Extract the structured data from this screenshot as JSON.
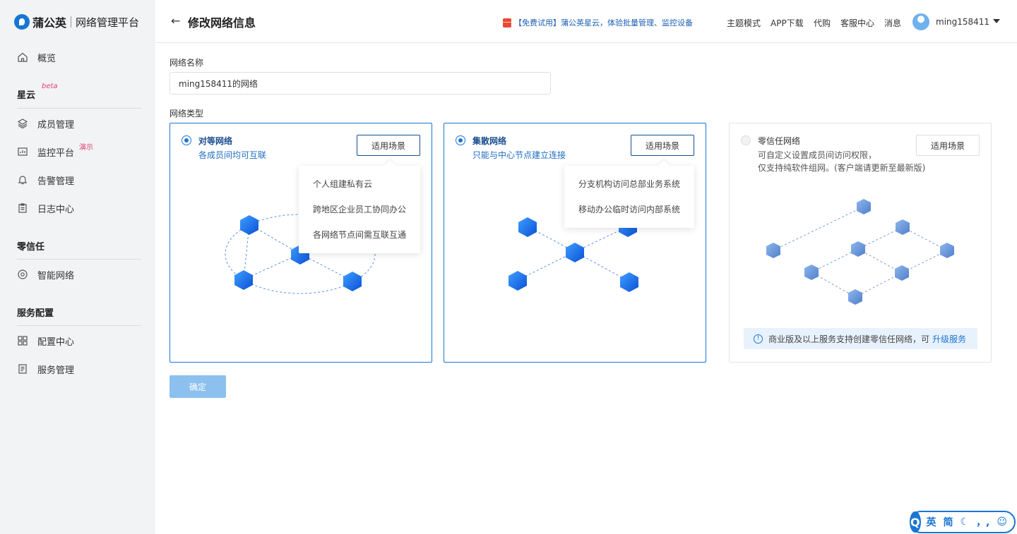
{
  "sidebar": {
    "brand": "蒲公英",
    "platform": "网络管理平台",
    "overview": "概览",
    "groups": [
      {
        "title": "星云",
        "badge": "beta",
        "items": [
          "成员管理",
          "监控平台",
          "告警管理",
          "日志中心"
        ],
        "item_badge": "演示"
      },
      {
        "title": "零信任",
        "items": [
          "智能网络"
        ]
      },
      {
        "title": "服务配置",
        "items": [
          "配置中心",
          "服务管理"
        ]
      }
    ]
  },
  "header": {
    "back": "←",
    "title": "修改网络信息",
    "promo": "【免费试用】蒲公英星云，体验批量管理、监控设备",
    "links": [
      "主题模式",
      "APP下载",
      "代购",
      "客服中心",
      "消息"
    ],
    "user": "ming158411"
  },
  "form": {
    "name_label": "网络名称",
    "name_value": "ming158411的网络",
    "type_label": "网络类型",
    "confirm": "确定"
  },
  "cards": [
    {
      "title": "对等网络",
      "desc": "各成员间均可互联",
      "selected": true,
      "scene_btn": "适用场景",
      "scenes": [
        "个人组建私有云",
        "跨地区企业员工协同办公",
        "各网络节点间需互联互通"
      ]
    },
    {
      "title": "集散网络",
      "desc": "只能与中心节点建立连接",
      "selected": true,
      "scene_btn": "适用场景",
      "scenes": [
        "分支机构访问总部业务系统",
        "移动办公临时访问内部系统"
      ]
    },
    {
      "title": "零信任网络",
      "desc": "可自定义设置成员间访问权限，",
      "desc2": "仅支持纯软件组网。(客户端请更新至最新版)",
      "selected": false,
      "scene_btn": "适用场景",
      "notice": "商业版及以上服务支持创建零信任网络，可",
      "upgrade": "升级服务"
    }
  ],
  "float_toolbar": {
    "letter": "Q",
    "items": [
      "英",
      "简",
      "☾",
      "，,",
      "☺"
    ]
  },
  "colors": {
    "accent": "#1a76d2",
    "sidebar_bg": "#f2f3f5",
    "confirm_disabled": "#8cc0ee"
  }
}
